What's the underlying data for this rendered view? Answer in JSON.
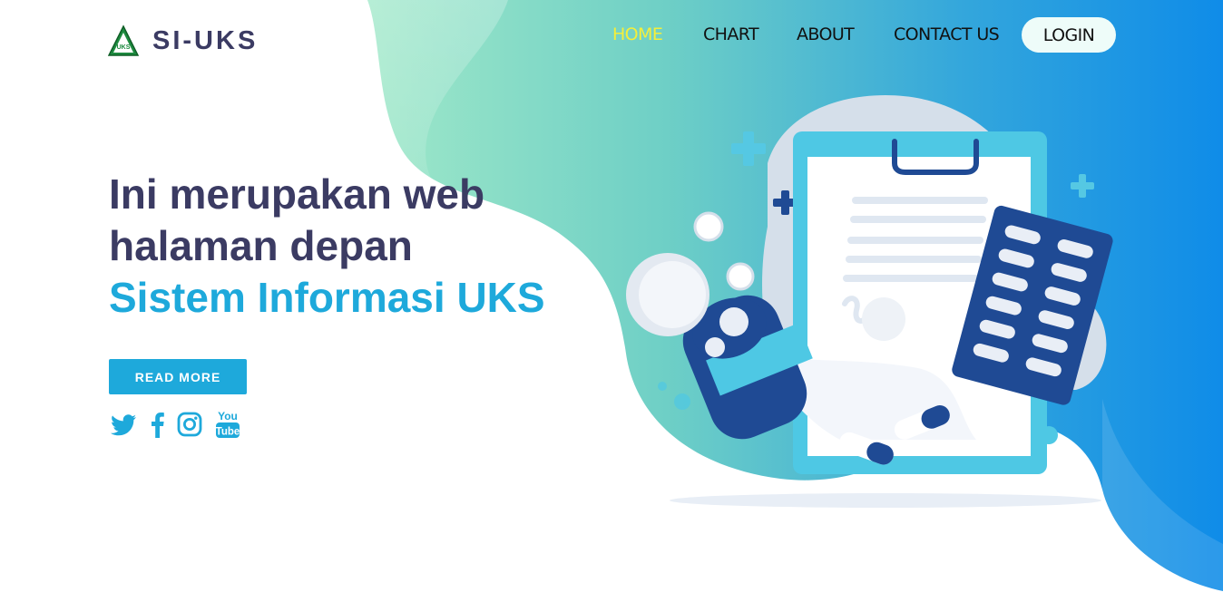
{
  "brand": {
    "name": "SI-UKS",
    "logo_mark_text": "UKS",
    "logo_icon": "uks-triangle-logo"
  },
  "nav": {
    "items": [
      {
        "label": "HOME",
        "active": true
      },
      {
        "label": "CHART",
        "active": false
      },
      {
        "label": "ABOUT",
        "active": false
      },
      {
        "label": "CONTACT US",
        "active": false
      }
    ],
    "login_label": "LOGIN"
  },
  "hero": {
    "line1": "Ini merupakan web",
    "line2": "halaman depan",
    "highlight": "Sistem Informasi UKS",
    "cta_label": "READ MORE"
  },
  "social_icons": [
    "twitter-icon",
    "facebook-icon",
    "instagram-icon",
    "youtube-icon"
  ],
  "colors": {
    "accent": "#1ea9db",
    "heading": "#3b3b63",
    "nav_active": "#f4ef3a",
    "gradient_start": "#8ee2c4",
    "gradient_end": "#0f8ce8",
    "illustration_navy": "#1f4a94"
  }
}
